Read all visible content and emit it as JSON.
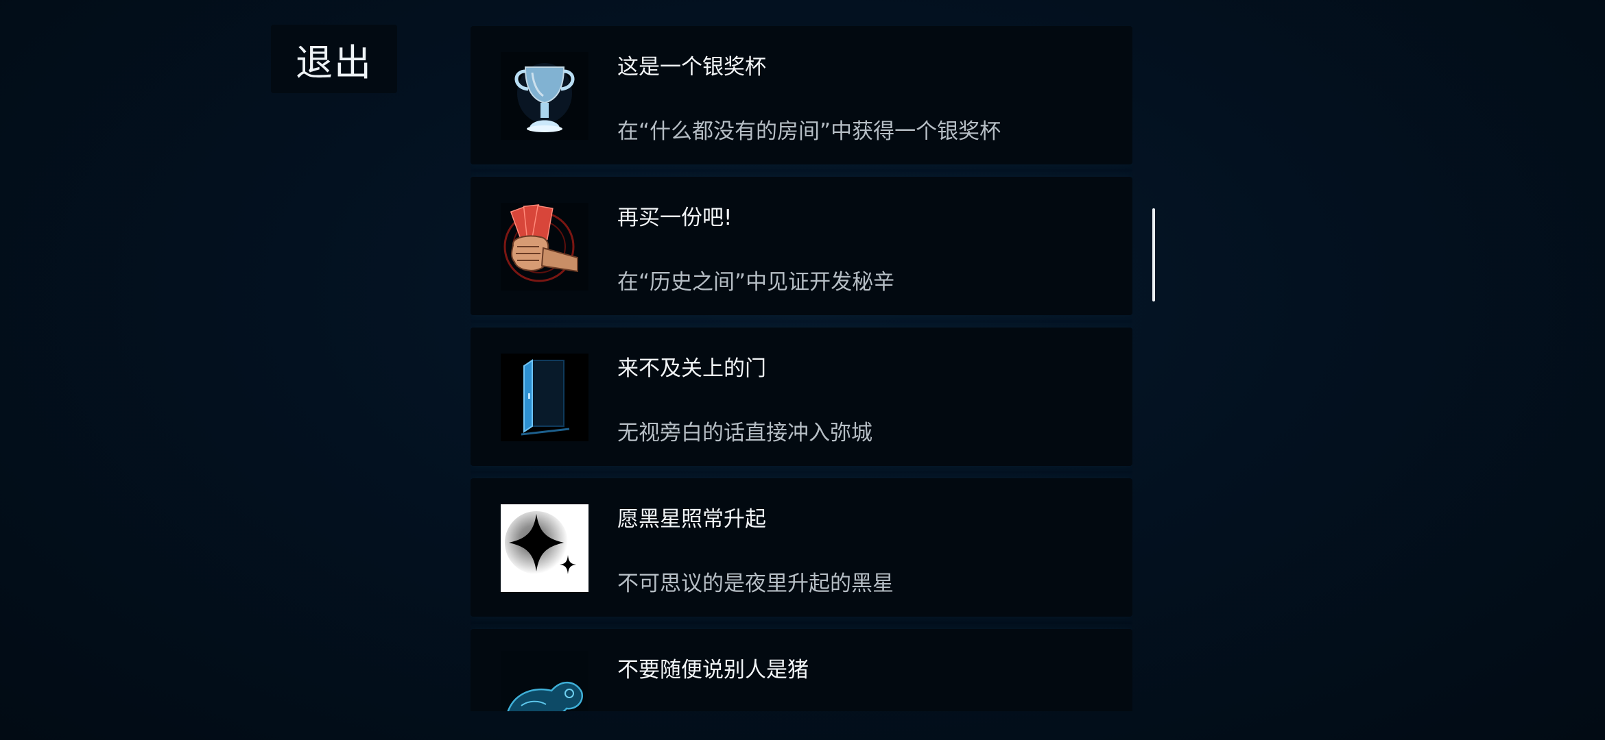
{
  "exit_button": {
    "label": "退出"
  },
  "achievements": [
    {
      "title": "这是一个银奖杯",
      "description": "在“什么都没有的房间”中获得一个银奖杯",
      "icon": "silver-trophy-icon"
    },
    {
      "title": "再买一份吧!",
      "description": "在“历史之间”中见证开发秘辛",
      "icon": "fist-holding-money-icon"
    },
    {
      "title": "来不及关上的门",
      "description": "无视旁白的话直接冲入弥城",
      "icon": "open-door-icon"
    },
    {
      "title": "愿黑星照常升起",
      "description": "不可思议的是夜里升起的黑星",
      "icon": "black-star-icon"
    },
    {
      "title": "不要随便说别人是猪",
      "description": "",
      "icon": "pig-figure-icon"
    }
  ],
  "colors": {
    "background": "#020d16",
    "card": "#020910",
    "title_text": "#f2f5f7",
    "desc_text": "#b6bec5",
    "scrollbar": "#e9eef2"
  }
}
